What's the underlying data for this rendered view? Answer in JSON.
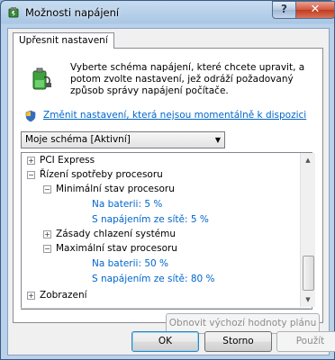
{
  "window": {
    "title": "Možnosti napájení",
    "help_label": "?",
    "close_label": "✕"
  },
  "tab": {
    "label": "Upřesnit nastavení"
  },
  "intro": {
    "text": "Vyberte schéma napájení, které chcete upravit, a potom zvolte nastavení, jež odráží požadovaný způsob správy napájení počítače."
  },
  "link": {
    "text": "Změnit nastavení, která nejsou momentálně k dispozici"
  },
  "scheme": {
    "selected": "Moje schéma [Aktivní]"
  },
  "tree": {
    "items": [
      {
        "label": "PCI Express",
        "expander": "+"
      },
      {
        "label": "Řízení spotřeby procesoru",
        "expander": "−"
      },
      {
        "label": "Minimální stav procesoru",
        "expander": "−"
      },
      {
        "label": "Na baterii: 5 %"
      },
      {
        "label": "S napájením ze sítě: 5 %"
      },
      {
        "label": "Zásady chlazení systému",
        "expander": "+"
      },
      {
        "label": "Maximální stav procesoru",
        "expander": "−"
      },
      {
        "label": "Na baterii: 50 %"
      },
      {
        "label": "S napájením ze sítě: 80 %"
      },
      {
        "label": "Zobrazení",
        "expander": "+"
      }
    ]
  },
  "buttons": {
    "restore": "Obnovit výchozí hodnoty plánu",
    "ok": "OK",
    "cancel": "Storno",
    "apply": "Použít"
  }
}
